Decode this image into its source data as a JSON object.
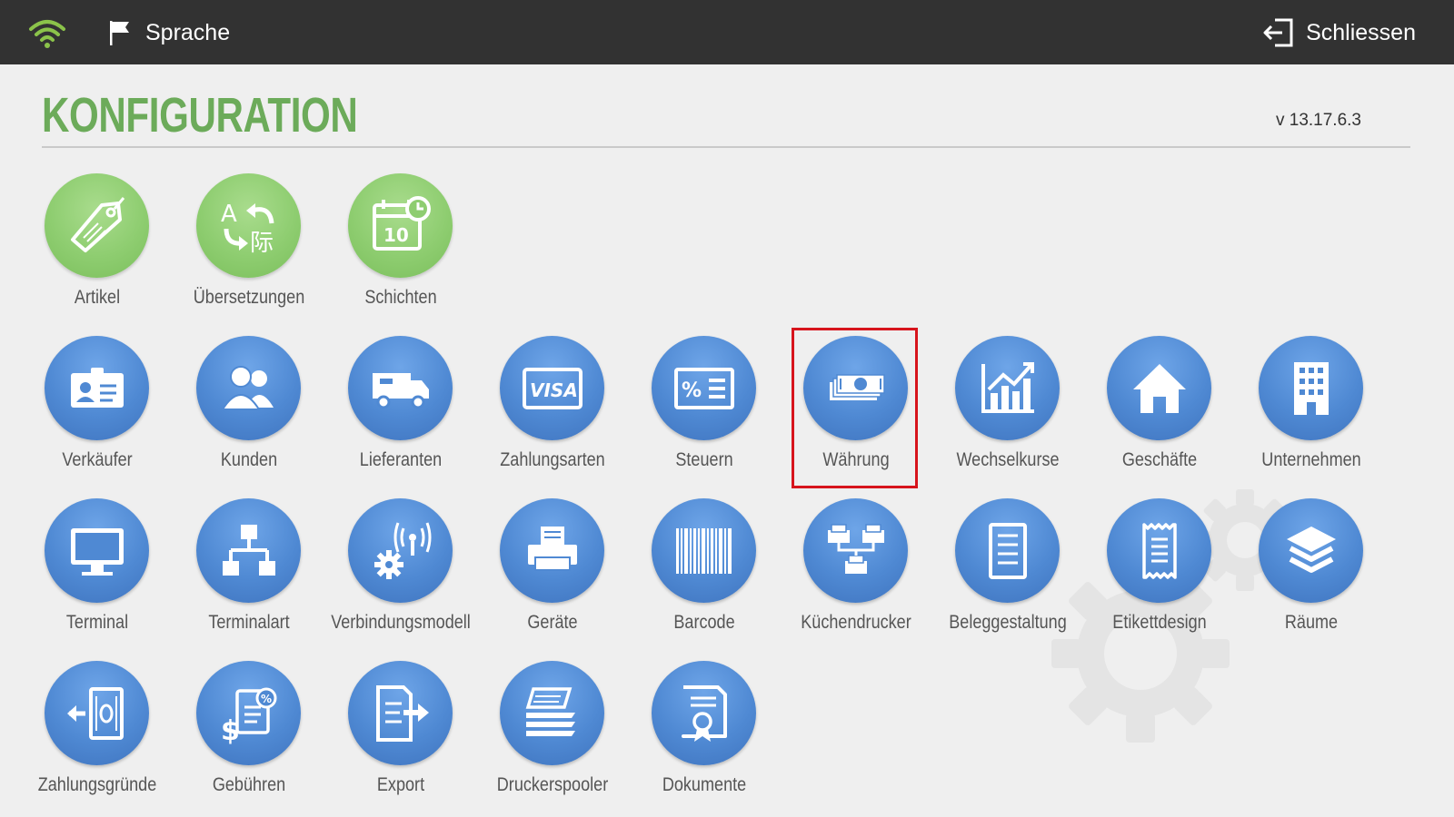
{
  "topbar": {
    "language_label": "Sprache",
    "close_label": "Schliessen"
  },
  "page": {
    "title": "KONFIGURATION",
    "version": "v 13.17.6.3"
  },
  "rows": [
    {
      "items": [
        {
          "label": "Artikel",
          "icon": "tag-icon",
          "color": "green"
        },
        {
          "label": "Übersetzungen",
          "icon": "translate-icon",
          "color": "green"
        },
        {
          "label": "Schichten",
          "icon": "calendar-clock-icon",
          "color": "green"
        }
      ]
    },
    {
      "items": [
        {
          "label": "Verkäufer",
          "icon": "id-card-icon",
          "color": "blue"
        },
        {
          "label": "Kunden",
          "icon": "users-icon",
          "color": "blue"
        },
        {
          "label": "Lieferanten",
          "icon": "truck-icon",
          "color": "blue"
        },
        {
          "label": "Zahlungsarten",
          "icon": "visa-card-icon",
          "color": "blue"
        },
        {
          "label": "Steuern",
          "icon": "percent-list-icon",
          "color": "blue"
        },
        {
          "label": "Währung",
          "icon": "banknotes-icon",
          "color": "blue",
          "highlighted": true
        },
        {
          "label": "Wechselkurse",
          "icon": "chart-up-icon",
          "color": "blue"
        },
        {
          "label": "Geschäfte",
          "icon": "house-icon",
          "color": "blue"
        },
        {
          "label": "Unternehmen",
          "icon": "building-icon",
          "color": "blue"
        }
      ]
    },
    {
      "items": [
        {
          "label": "Terminal",
          "icon": "monitor-icon",
          "color": "blue"
        },
        {
          "label": "Terminalart",
          "icon": "hierarchy-icon",
          "color": "blue"
        },
        {
          "label": "Verbindungsmodell",
          "icon": "antenna-gear-icon",
          "color": "blue"
        },
        {
          "label": "Geräte",
          "icon": "printer-icon",
          "color": "blue"
        },
        {
          "label": "Barcode",
          "icon": "barcode-icon",
          "color": "blue"
        },
        {
          "label": "Küchendrucker",
          "icon": "printer-network-icon",
          "color": "blue"
        },
        {
          "label": "Beleggestaltung",
          "icon": "document-lines-icon",
          "color": "blue"
        },
        {
          "label": "Etikettdesign",
          "icon": "label-roll-icon",
          "color": "blue"
        },
        {
          "label": "Räume",
          "icon": "layers-icon",
          "color": "blue"
        }
      ]
    },
    {
      "items": [
        {
          "label": "Zahlungsgründe",
          "icon": "cash-out-icon",
          "color": "blue"
        },
        {
          "label": "Gebühren",
          "icon": "fees-icon",
          "color": "blue"
        },
        {
          "label": "Export",
          "icon": "export-icon",
          "color": "blue"
        },
        {
          "label": "Druckerspooler",
          "icon": "paper-stack-icon",
          "color": "blue"
        },
        {
          "label": "Dokumente",
          "icon": "certificate-icon",
          "color": "blue"
        }
      ]
    }
  ],
  "colors": {
    "topbar": "#323232",
    "title_green": "#6cab5a",
    "wifi_green": "#8bc34a",
    "highlight_red": "#d7141c"
  }
}
